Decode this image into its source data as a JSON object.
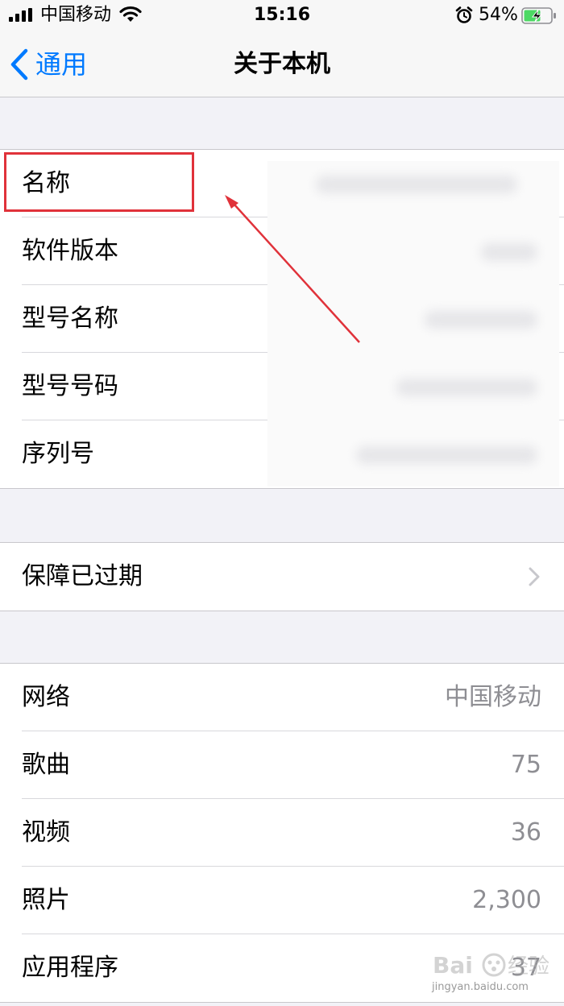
{
  "status_bar": {
    "carrier": "中国移动",
    "time": "15:16",
    "battery_percent": "54%"
  },
  "nav": {
    "back_label": "通用",
    "title": "关于本机"
  },
  "group1": [
    {
      "label": "名称"
    },
    {
      "label": "软件版本"
    },
    {
      "label": "型号名称"
    },
    {
      "label": "型号号码"
    },
    {
      "label": "序列号"
    }
  ],
  "group2": [
    {
      "label": "保障已过期"
    }
  ],
  "group3": [
    {
      "label": "网络",
      "value": "中国移动"
    },
    {
      "label": "歌曲",
      "value": "75"
    },
    {
      "label": "视频",
      "value": "36"
    },
    {
      "label": "照片",
      "value": "2,300"
    },
    {
      "label": "应用程序",
      "value": "37"
    }
  ],
  "annotation": {
    "highlight_color": "#e0323a"
  },
  "watermark": {
    "text": "jingyan.baidu.com"
  },
  "colors": {
    "accent": "#007aff",
    "secondary_text": "#8e8e93",
    "background": "#f2f2f7"
  }
}
